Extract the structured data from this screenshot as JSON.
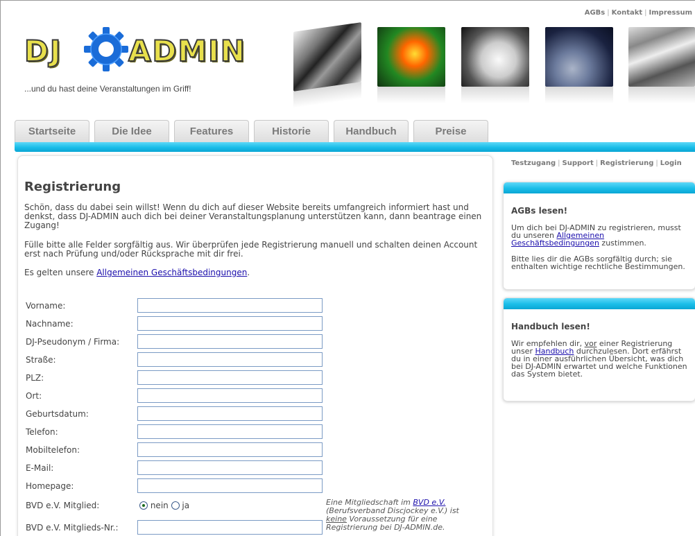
{
  "colors": {
    "accent": "#19bde8",
    "link": "#1a0dab",
    "tab_text": "#7a7a7a",
    "logo_yellow": "#e8e04c",
    "gear_blue": "#1a6cd8"
  },
  "toplinks": {
    "agbs": "AGBs",
    "kontakt": "Kontakt",
    "impressum": "Impressum",
    "sep": "|"
  },
  "logo": {
    "dj": "DJ",
    "admin": "ADMIN",
    "tagline": "...und du hast deine Veranstaltungen im Griff!"
  },
  "header_images": [
    "mixer-icon",
    "laser-icon",
    "speaker-icon",
    "jack-cable-icon",
    "flight-case-icon"
  ],
  "nav": {
    "tabs": [
      "Startseite",
      "Die Idee",
      "Features",
      "Historie",
      "Handbuch",
      "Preise"
    ]
  },
  "main": {
    "title": "Registrierung",
    "p1": "Schön, dass du dabei sein willst! Wenn du dich auf dieser Website bereits umfangreich informiert hast und denkst, dass DJ-ADMIN auch dich bei deiner Veranstaltungsplanung unterstützen kann, dann beantrage einen Zugang!",
    "p2": "Fülle bitte alle Felder sorgfältig aus. Wir überprüfen jede Registrierung manuell und schalten deinen Account erst nach Prüfung und/oder Rücksprache mit dir frei.",
    "p3_prefix": "Es gelten unsere ",
    "p3_link": "Allgemeinen Geschäftsbedingungen",
    "p3_suffix": "."
  },
  "form": {
    "fields": [
      {
        "label": "Vorname:",
        "value": ""
      },
      {
        "label": "Nachname:",
        "value": ""
      },
      {
        "label": "DJ-Pseudonym / Firma:",
        "value": ""
      },
      {
        "label": "Straße:",
        "value": ""
      },
      {
        "label": "PLZ:",
        "value": ""
      },
      {
        "label": "Ort:",
        "value": ""
      },
      {
        "label": "Geburtsdatum:",
        "value": ""
      },
      {
        "label": "Telefon:",
        "value": ""
      },
      {
        "label": "Mobiltelefon:",
        "value": ""
      },
      {
        "label": "E-Mail:",
        "value": ""
      },
      {
        "label": "Homepage:",
        "value": ""
      }
    ],
    "bvd_member_label": "BVD e.V. Mitglied:",
    "bvd_no": "nein",
    "bvd_yes": "ja",
    "bvd_selected": "nein",
    "bvd_nr_label": "BVD e.V. Mitglieds-Nr.:",
    "bvd_note": {
      "prefix": "Eine Mitgliedschaft im ",
      "link": "BVD e.V.",
      "mid": " (Berufsverband Discjockey e.V.) ist ",
      "keine": "keine",
      "suffix": " Voraussetzung für eine Registrierung bei DJ-ADMIN.de."
    }
  },
  "sidelinks": {
    "testzugang": "Testzugang",
    "support": "Support",
    "registrierung": "Registrierung",
    "login": "Login",
    "sep": "|"
  },
  "side1": {
    "title": "AGBs lesen!",
    "p1_prefix": "Um dich bei DJ-ADMIN zu registrieren, musst du unseren ",
    "p1_link": "Allgemeinen Geschäftsbedingungen",
    "p1_suffix": " zustimmen.",
    "p2": "Bitte lies dir die AGBs sorgfältig durch; sie enthalten wichtige rechtliche Bestimmungen."
  },
  "side2": {
    "title": "Handbuch lesen!",
    "p_prefix": "Wir empfehlen dir, ",
    "p_vor": "vor",
    "p_mid": " einer Registrierung unser ",
    "p_link": "Handbuch",
    "p_suffix": " durchzulesen. Dort erfährst du in einer ausführlichen Übersicht, was dich bei DJ-ADMIN erwartet und welche Funktionen das System bietet."
  }
}
